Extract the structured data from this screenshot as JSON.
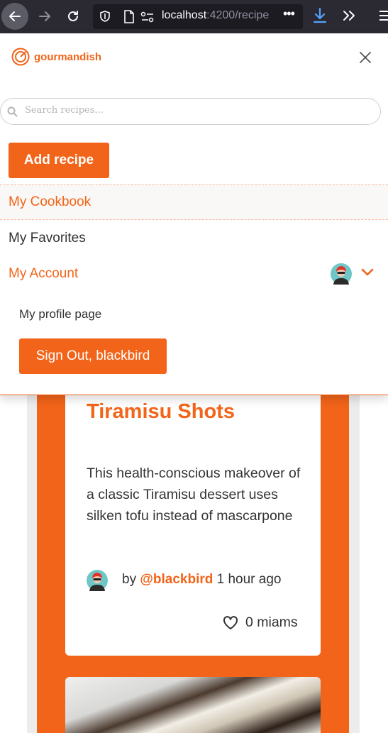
{
  "browser": {
    "url_host": "localhost",
    "url_rest": ":4200/recipe",
    "more_label": "•••"
  },
  "app": {
    "logo_text": "gourmandish",
    "brand_color": "#f26419"
  },
  "search": {
    "placeholder": "Search recipes..."
  },
  "menu": {
    "add_recipe_label": "Add recipe",
    "items": [
      {
        "label": "My Cookbook",
        "active": true
      },
      {
        "label": "My Favorites",
        "active": false
      },
      {
        "label": "My Account",
        "active": false
      }
    ],
    "account_submenu": {
      "profile_link": "My profile page",
      "signout_label": "Sign Out, blackbird"
    }
  },
  "recipe_card": {
    "title": "Tiramisu Shots",
    "description": "This health-conscious makeover of a classic Tiramisu dessert uses silken tofu instead of mascarpone",
    "by_prefix": "by",
    "author_handle": "@blackbird",
    "time_ago": "1 hour ago",
    "likes_label": "0 miams"
  },
  "icons": [
    "back-arrow-icon",
    "forward-arrow-icon",
    "reload-icon",
    "shield-icon",
    "page-icon",
    "permissions-icon",
    "download-icon",
    "overflow-icon",
    "hamburger-icon",
    "logo-icon",
    "close-icon",
    "search-icon",
    "avatar",
    "chevron-down-icon",
    "heart-icon"
  ]
}
